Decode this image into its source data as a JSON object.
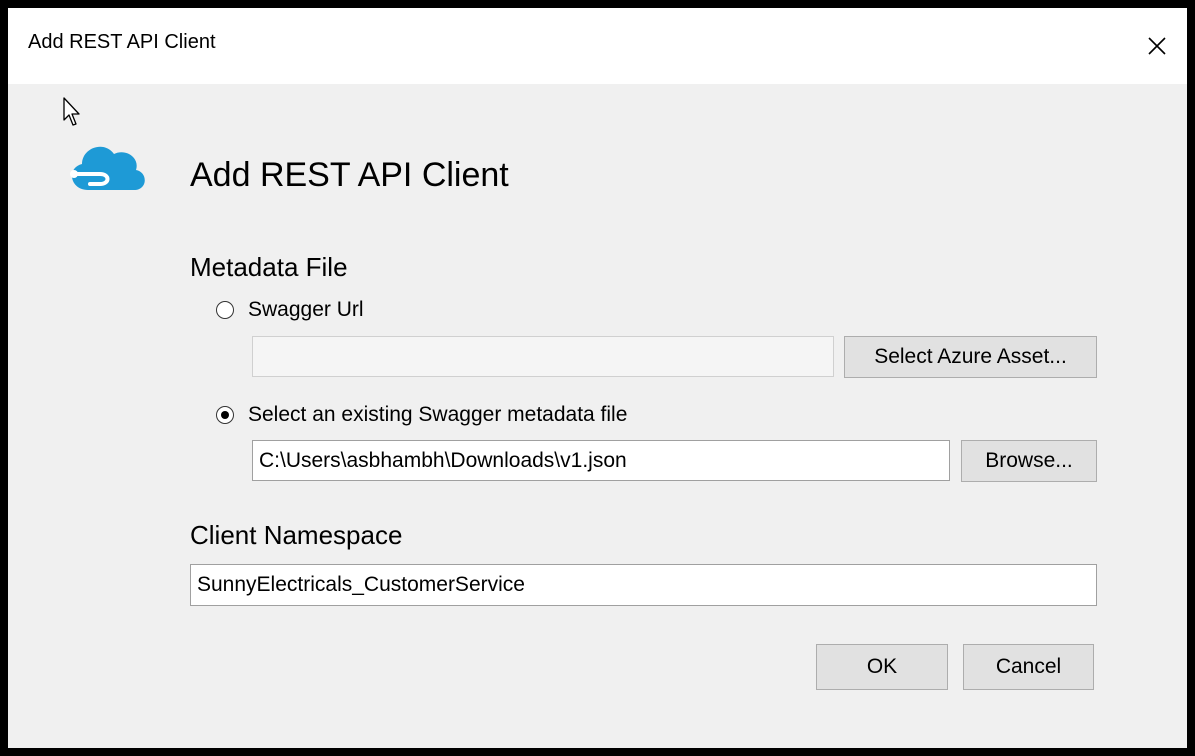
{
  "window": {
    "title": "Add REST API Client"
  },
  "heading": "Add REST API Client",
  "metadata": {
    "label": "Metadata File",
    "swagger_url": {
      "label": "Swagger Url",
      "value": "",
      "checked": false,
      "asset_button": "Select Azure Asset..."
    },
    "existing_file": {
      "label": "Select an existing Swagger metadata file",
      "value": "C:\\Users\\asbhambh\\Downloads\\v1.json",
      "checked": true,
      "browse_button": "Browse..."
    }
  },
  "namespace": {
    "label": "Client Namespace",
    "value": "SunnyElectricals_CustomerService"
  },
  "buttons": {
    "ok": "OK",
    "cancel": "Cancel"
  },
  "icons": {
    "logo": "azure-cloud-icon",
    "close": "close-icon",
    "cursor": "mouse-pointer-icon"
  },
  "colors": {
    "logo_blue": "#1e9ad6",
    "window_bg": "#f0f0f0",
    "border": "#000000"
  }
}
